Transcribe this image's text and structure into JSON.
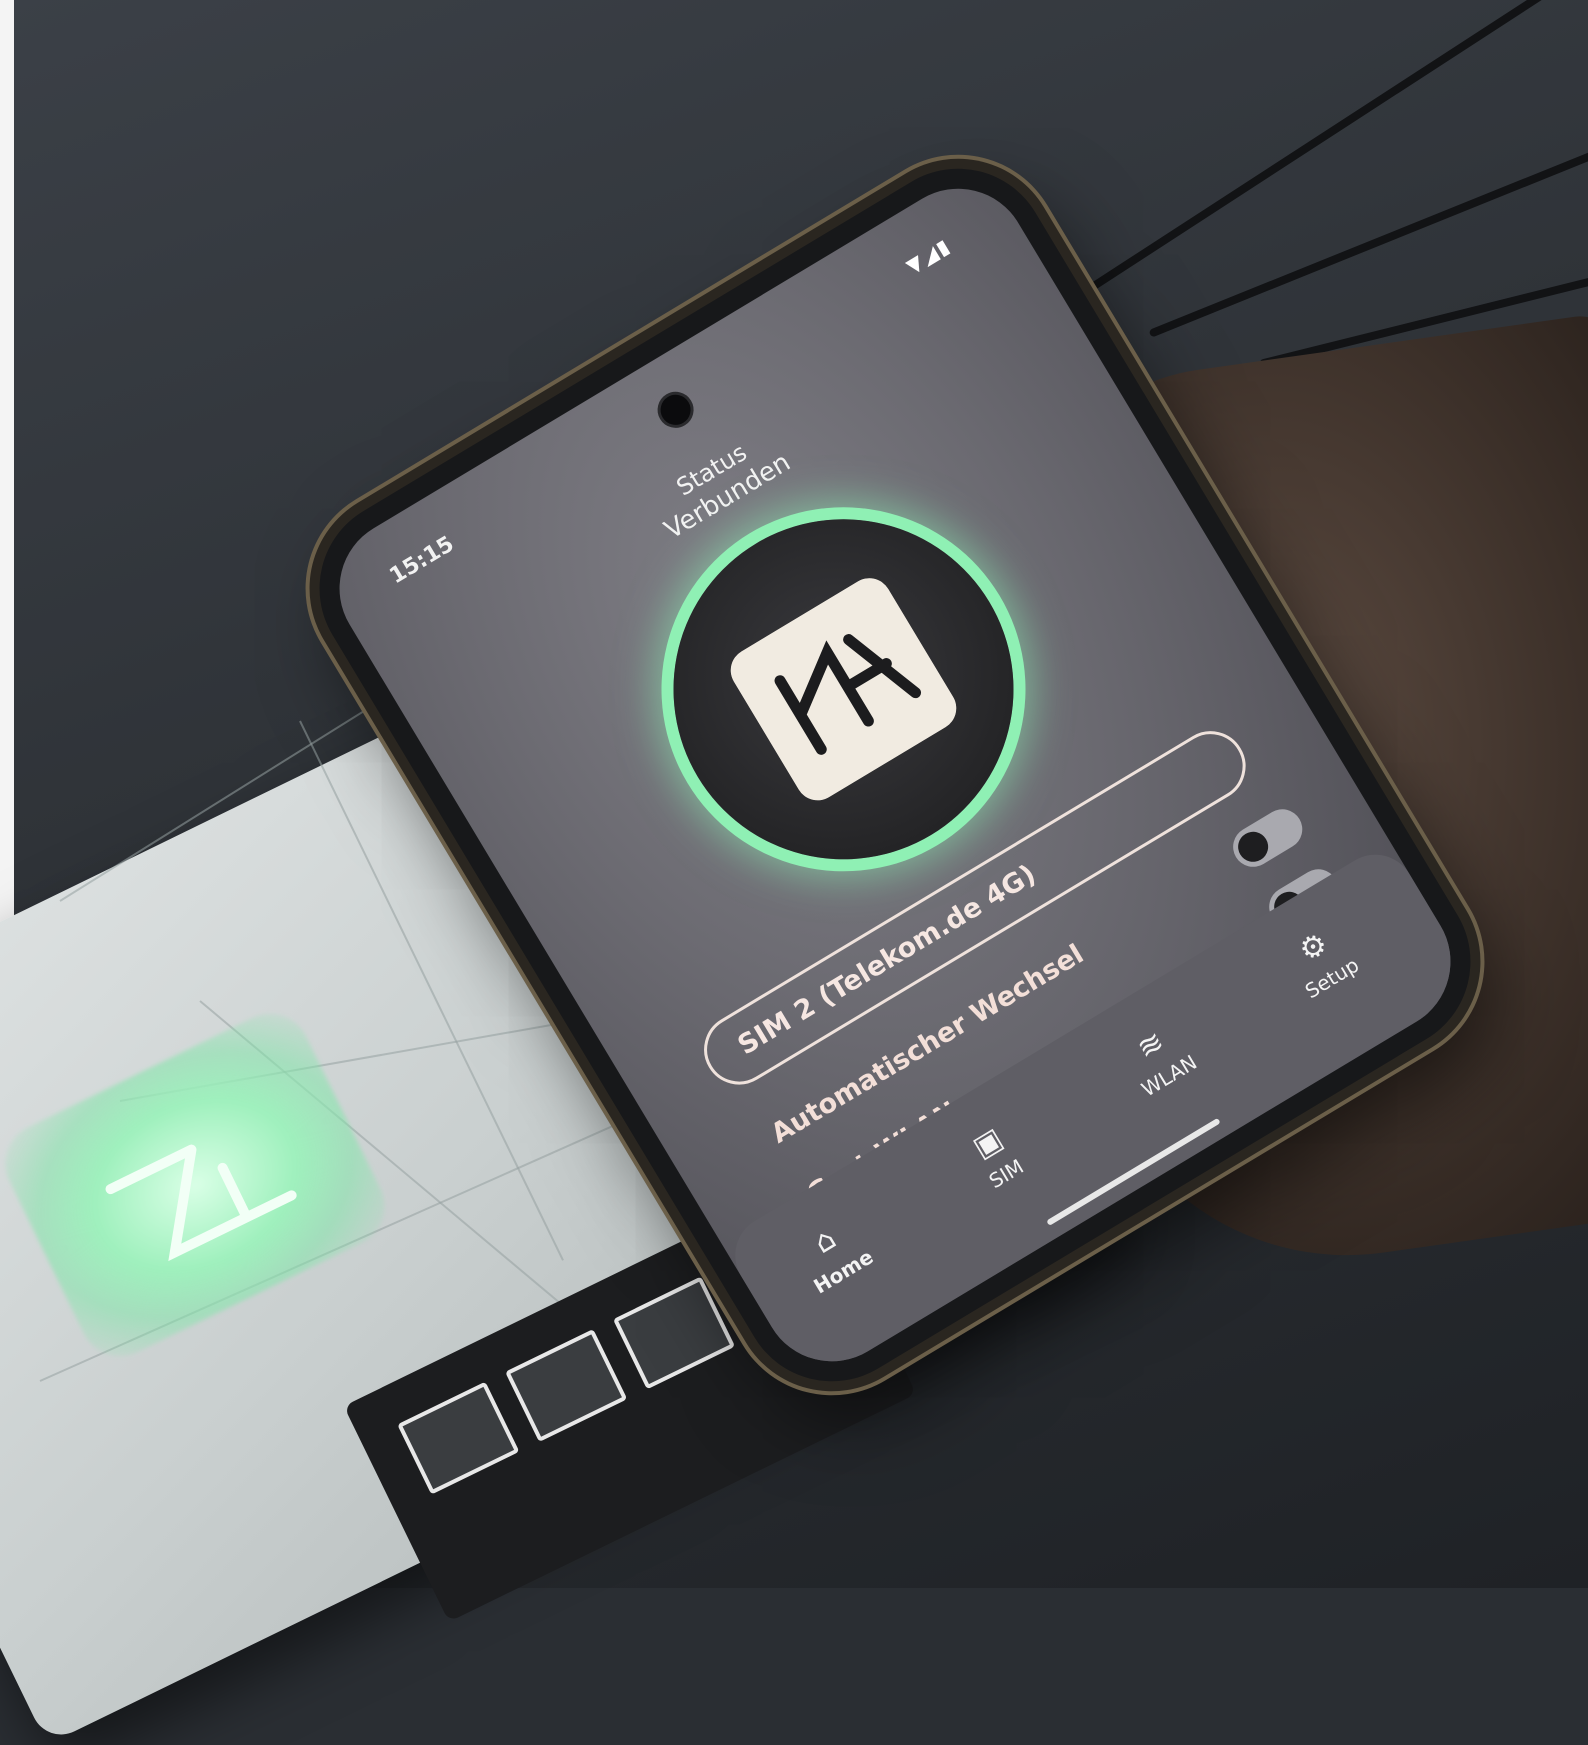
{
  "phone": {
    "status_bar": {
      "time": "15:15"
    },
    "header": {
      "label": "Status",
      "value": "Verbunden"
    },
    "connection_ring_color": "#8ff0b4",
    "sim_selector": {
      "label": "SIM 2 (Telekom.de 4G)"
    },
    "options": [
      {
        "label": "Automatischer Wechsel"
      },
      {
        "label": "Gast-WLAN"
      }
    ],
    "bottom_nav": [
      {
        "label": "Home",
        "icon": "home-icon",
        "active": true
      },
      {
        "label": "SIM",
        "icon": "sim-card-icon",
        "active": false
      },
      {
        "label": "WLAN",
        "icon": "wifi-icon",
        "active": false
      },
      {
        "label": "Setup",
        "icon": "gear-icon",
        "active": false
      }
    ]
  },
  "router": {
    "logo_glow_color": "#9ff0bd"
  }
}
